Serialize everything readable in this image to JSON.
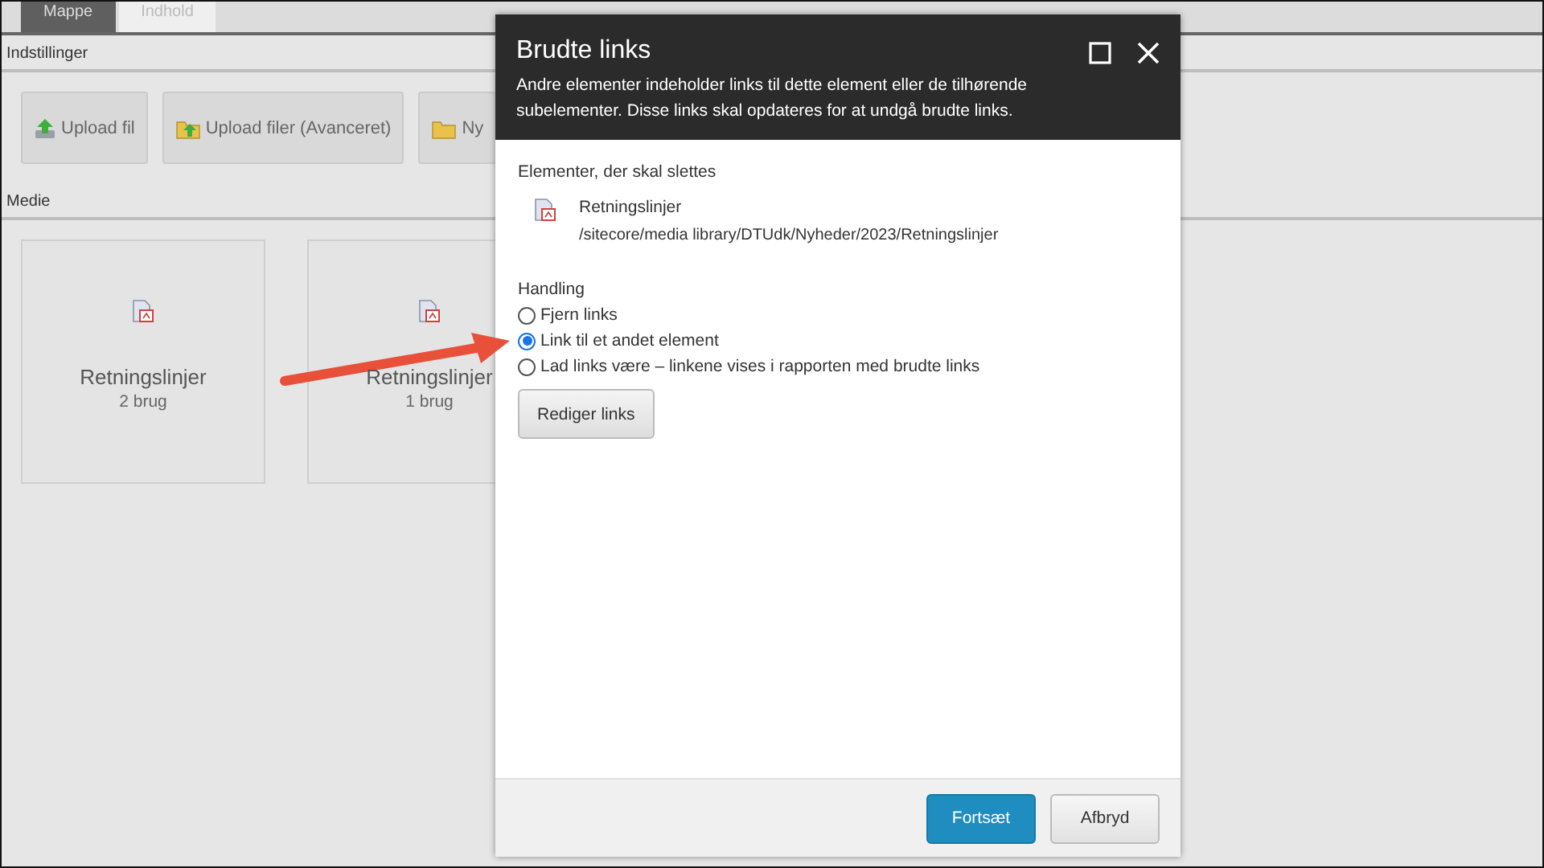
{
  "page": {
    "tabs": [
      {
        "label": "Mappe",
        "selected": true
      },
      {
        "label": "Indhold",
        "selected": false
      }
    ],
    "settings_label": "Indstillinger",
    "toolbar": [
      {
        "label": "Upload fil",
        "kind": "upload"
      },
      {
        "label": "Upload filer (Avanceret)",
        "kind": "upload-advanced"
      },
      {
        "label": "Ny",
        "kind": "folder"
      }
    ],
    "media_label": "Medie",
    "media_items": [
      {
        "name": "Retningslinjer",
        "usage": "2 brug"
      },
      {
        "name": "Retningslinjer",
        "usage": "1 brug"
      }
    ]
  },
  "dialog": {
    "title": "Brudte links",
    "description": "Andre elementer indeholder links til dette element eller de tilhørende subelementer. Disse links skal opdateres for at undgå brudte links.",
    "items_label": "Elementer, der skal slettes",
    "items": [
      {
        "name": "Retningslinjer",
        "path": "/sitecore/media library/DTUdk/Nyheder/2023/Retningslinjer"
      }
    ],
    "action_label": "Handling",
    "options": [
      {
        "label": "Fjern links",
        "selected": false
      },
      {
        "label": "Link til et andet element",
        "selected": true
      },
      {
        "label": "Lad links være – linkene vises i rapporten med brudte links",
        "selected": false
      }
    ],
    "edit_button": "Rediger links",
    "buttons": [
      {
        "label": "Fortsæt",
        "kind": "primary"
      },
      {
        "label": "Afbryd",
        "kind": "secondary"
      }
    ]
  }
}
